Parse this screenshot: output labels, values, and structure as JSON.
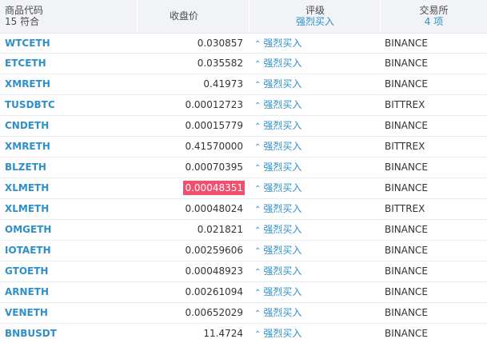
{
  "header": {
    "symbol_title": "商品代码",
    "symbol_count": "15 符合",
    "close_title": "收盘价",
    "rating_title": "评级",
    "rating_filter": "强烈买入",
    "exchange_title": "交易所",
    "exchange_count": "4 项"
  },
  "colors": {
    "link": "#2f8fc9",
    "highlight": "#f0506e",
    "header_bg": "#f1f3f6"
  },
  "icons": {
    "rating": "double-chevron-up-icon"
  },
  "rows": [
    {
      "symbol": "WTCETH",
      "close": "0.030857",
      "rating": "强烈买入",
      "exchange": "BINANCE",
      "highlight": false
    },
    {
      "symbol": "ETCETH",
      "close": "0.035582",
      "rating": "强烈买入",
      "exchange": "BINANCE",
      "highlight": false
    },
    {
      "symbol": "XMRETH",
      "close": "0.41973",
      "rating": "强烈买入",
      "exchange": "BINANCE",
      "highlight": false
    },
    {
      "symbol": "TUSDBTC",
      "close": "0.00012723",
      "rating": "强烈买入",
      "exchange": "BITTREX",
      "highlight": false
    },
    {
      "symbol": "CNDETH",
      "close": "0.00015779",
      "rating": "强烈买入",
      "exchange": "BINANCE",
      "highlight": false
    },
    {
      "symbol": "XMRETH",
      "close": "0.41570000",
      "rating": "强烈买入",
      "exchange": "BITTREX",
      "highlight": false
    },
    {
      "symbol": "BLZETH",
      "close": "0.00070395",
      "rating": "强烈买入",
      "exchange": "BINANCE",
      "highlight": false
    },
    {
      "symbol": "XLMETH",
      "close": "0.00048351",
      "rating": "强烈买入",
      "exchange": "BINANCE",
      "highlight": true
    },
    {
      "symbol": "XLMETH",
      "close": "0.00048024",
      "rating": "强烈买入",
      "exchange": "BITTREX",
      "highlight": false
    },
    {
      "symbol": "OMGETH",
      "close": "0.021821",
      "rating": "强烈买入",
      "exchange": "BINANCE",
      "highlight": false
    },
    {
      "symbol": "IOTAETH",
      "close": "0.00259606",
      "rating": "强烈买入",
      "exchange": "BINANCE",
      "highlight": false
    },
    {
      "symbol": "GTOETH",
      "close": "0.00048923",
      "rating": "强烈买入",
      "exchange": "BINANCE",
      "highlight": false
    },
    {
      "symbol": "ARNETH",
      "close": "0.00261094",
      "rating": "强烈买入",
      "exchange": "BINANCE",
      "highlight": false
    },
    {
      "symbol": "VENETH",
      "close": "0.00652029",
      "rating": "强烈买入",
      "exchange": "BINANCE",
      "highlight": false
    },
    {
      "symbol": "BNBUSDT",
      "close": "11.4724",
      "rating": "强烈买入",
      "exchange": "BINANCE",
      "highlight": false
    }
  ]
}
